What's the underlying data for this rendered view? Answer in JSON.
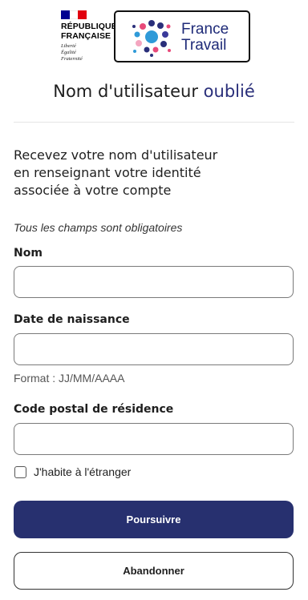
{
  "header": {
    "rf_logo": {
      "name_lines": [
        "RÉPUBLIQUE",
        "FRANÇAISE"
      ],
      "motto_lines": [
        "Liberté",
        "Égalité",
        "Fraternité"
      ]
    },
    "brand": {
      "name_lines": [
        "France",
        "Travail"
      ],
      "color": "#1e2a78"
    }
  },
  "page": {
    "title_start": "Nom d'utilisateur ",
    "title_accent": "oublié",
    "intro_lines": [
      "Recevez votre nom d'utilisateur",
      "en renseignant votre identité",
      "associée à votre compte"
    ],
    "required_note": "Tous les champs sont obligatoires"
  },
  "form": {
    "nom": {
      "label": "Nom",
      "value": ""
    },
    "date_naissance": {
      "label": "Date de naissance",
      "value": "",
      "hint": "Format : JJ/MM/AAAA"
    },
    "code_postal": {
      "label": "Code postal de résidence",
      "value": ""
    },
    "etranger": {
      "label": "J'habite à l'étranger",
      "checked": false
    }
  },
  "actions": {
    "submit_label": "Poursuivre",
    "cancel_label": "Abandonner"
  },
  "colors": {
    "primary": "#27306f",
    "accent_title": "#2a2f7a"
  }
}
